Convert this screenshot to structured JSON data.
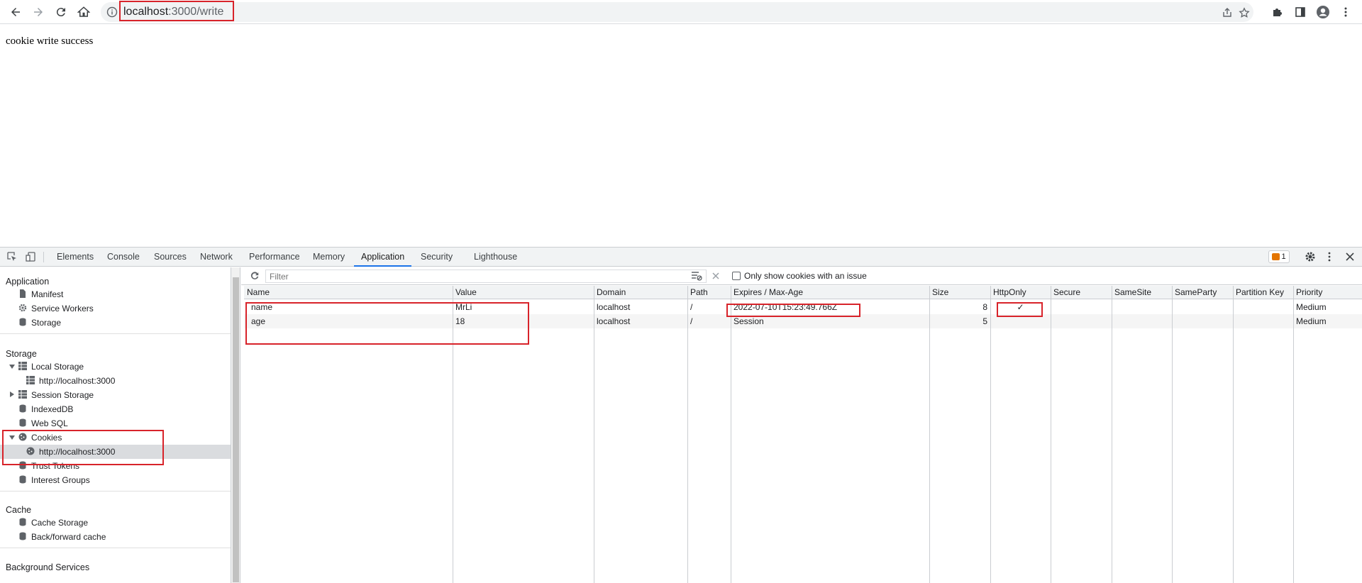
{
  "browser": {
    "url_host": "localhost",
    "url_path": ":3000/write"
  },
  "page": {
    "text": "cookie write success"
  },
  "devtools": {
    "tabs": [
      "Elements",
      "Console",
      "Sources",
      "Network",
      "Performance",
      "Memory",
      "Application",
      "Security",
      "Lighthouse"
    ],
    "active_tab": "Application",
    "issues_count": "1"
  },
  "sidebar": {
    "application_header": "Application",
    "application_items": [
      "Manifest",
      "Service Workers",
      "Storage"
    ],
    "storage_header": "Storage",
    "local_storage": "Local Storage",
    "local_storage_origin": "http://localhost:3000",
    "session_storage": "Session Storage",
    "indexeddb": "IndexedDB",
    "websql": "Web SQL",
    "cookies": "Cookies",
    "cookies_origin": "http://localhost:3000",
    "trust_tokens": "Trust Tokens",
    "interest_groups": "Interest Groups",
    "cache_header": "Cache",
    "cache_storage": "Cache Storage",
    "back_forward_cache": "Back/forward cache",
    "background_header": "Background Services"
  },
  "filter": {
    "placeholder": "Filter",
    "only_issue_label": "Only show cookies with an issue"
  },
  "table": {
    "columns": [
      "Name",
      "Value",
      "Domain",
      "Path",
      "Expires / Max-Age",
      "Size",
      "HttpOnly",
      "Secure",
      "SameSite",
      "SameParty",
      "Partition Key",
      "Priority"
    ],
    "rows": [
      {
        "name": "name",
        "value": "MrLi",
        "domain": "localhost",
        "path": "/",
        "expires": "2022-07-10T15:23:49.766Z",
        "size": "8",
        "httponly": "✓",
        "secure": "",
        "samesite": "",
        "sameparty": "",
        "partition": "",
        "priority": "Medium"
      },
      {
        "name": "age",
        "value": "18",
        "domain": "localhost",
        "path": "/",
        "expires": "Session",
        "size": "5",
        "httponly": "",
        "secure": "",
        "samesite": "",
        "sameparty": "",
        "partition": "",
        "priority": "Medium"
      }
    ]
  },
  "colors": {
    "highlight": "#d8232a",
    "accent": "#1a73e8"
  }
}
